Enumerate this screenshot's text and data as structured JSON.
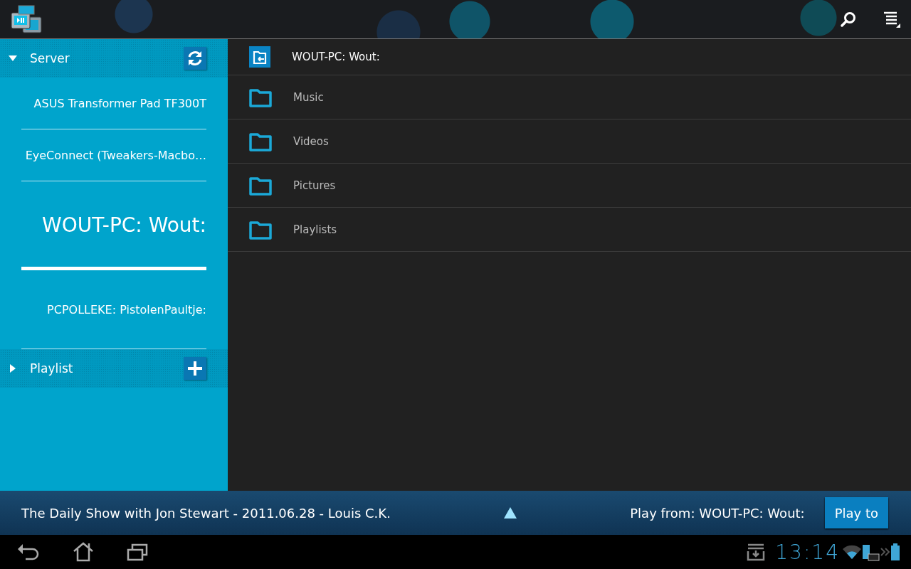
{
  "sidebar": {
    "sections": [
      {
        "kind": "server",
        "title": "Server",
        "expanded": true,
        "items": [
          {
            "label": "ASUS Transformer Pad TF300T",
            "selected": false
          },
          {
            "label": "EyeConnect (Tweakers-Macbo…",
            "selected": false
          },
          {
            "label": "WOUT-PC: Wout:",
            "selected": true
          },
          {
            "label": "PCPOLLEKE: PistolenPaultje:",
            "selected": false
          }
        ]
      },
      {
        "kind": "playlist",
        "title": "Playlist",
        "expanded": false
      }
    ]
  },
  "browser": {
    "path": "WOUT-PC: Wout:",
    "folders": [
      {
        "label": "Music"
      },
      {
        "label": "Videos"
      },
      {
        "label": "Pictures"
      },
      {
        "label": "Playlists"
      }
    ]
  },
  "now_playing": {
    "title": "The Daily Show with Jon Stewart - 2011.06.28 - Louis C.K.",
    "play_from": "Play from: WOUT-PC: Wout:",
    "play_to": "Play to"
  },
  "system_bar": {
    "time": "13:14"
  }
}
